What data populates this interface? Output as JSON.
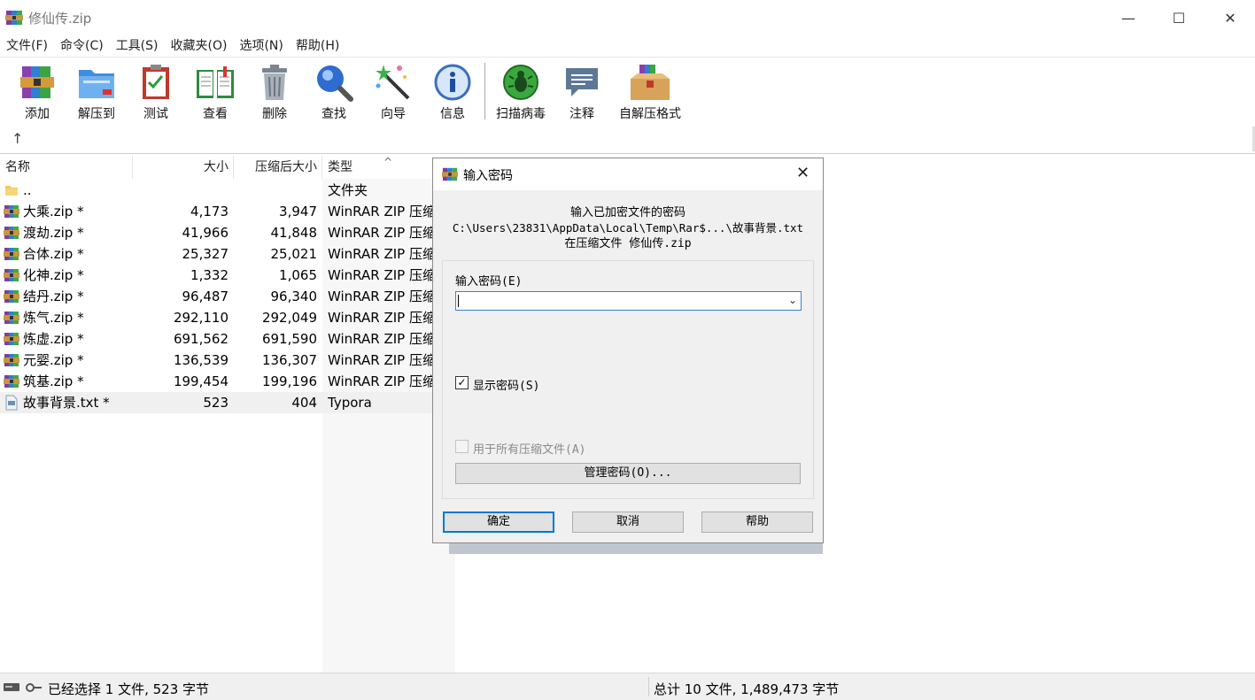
{
  "window": {
    "title": "修仙传.zip",
    "minimize": "—",
    "maximize": "☐",
    "close": "✕"
  },
  "menu": [
    "文件(F)",
    "命令(C)",
    "工具(S)",
    "收藏夹(O)",
    "选项(N)",
    "帮助(H)"
  ],
  "toolbar": {
    "buttons": [
      "添加",
      "解压到",
      "测试",
      "查看",
      "删除",
      "查找",
      "向导",
      "信息",
      "扫描病毒",
      "注释",
      "自解压格式"
    ],
    "up_arrow": "↑"
  },
  "list": {
    "headers": {
      "name": "名称",
      "size": "大小",
      "packed": "压缩后大小",
      "type": "类型"
    },
    "sort_indicator": "^",
    "rows": [
      {
        "name": "..",
        "size": "",
        "packed": "",
        "type": "文件夹",
        "icon": "folder-icon"
      },
      {
        "name": "大乘.zip *",
        "size": "4,173",
        "packed": "3,947",
        "type": "WinRAR ZIP 压缩",
        "icon": "winrar-archive-icon"
      },
      {
        "name": "渡劫.zip *",
        "size": "41,966",
        "packed": "41,848",
        "type": "WinRAR ZIP 压缩",
        "icon": "winrar-archive-icon"
      },
      {
        "name": "合体.zip *",
        "size": "25,327",
        "packed": "25,021",
        "type": "WinRAR ZIP 压缩",
        "icon": "winrar-archive-icon"
      },
      {
        "name": "化神.zip *",
        "size": "1,332",
        "packed": "1,065",
        "type": "WinRAR ZIP 压缩",
        "icon": "winrar-archive-icon"
      },
      {
        "name": "结丹.zip *",
        "size": "96,487",
        "packed": "96,340",
        "type": "WinRAR ZIP 压缩",
        "icon": "winrar-archive-icon"
      },
      {
        "name": "炼气.zip *",
        "size": "292,110",
        "packed": "292,049",
        "type": "WinRAR ZIP 压缩",
        "icon": "winrar-archive-icon"
      },
      {
        "name": "炼虚.zip *",
        "size": "691,562",
        "packed": "691,590",
        "type": "WinRAR ZIP 压缩",
        "icon": "winrar-archive-icon"
      },
      {
        "name": "元婴.zip *",
        "size": "136,539",
        "packed": "136,307",
        "type": "WinRAR ZIP 压缩",
        "icon": "winrar-archive-icon"
      },
      {
        "name": "筑基.zip *",
        "size": "199,454",
        "packed": "199,196",
        "type": "WinRAR ZIP 压缩",
        "icon": "winrar-archive-icon"
      },
      {
        "name": "故事背景.txt *",
        "size": "523",
        "packed": "404",
        "type": "Typora",
        "icon": "text-file-icon",
        "selected": true
      }
    ]
  },
  "status": {
    "left": "已经选择 1 文件, 523 字节",
    "right": "总计 10 文件, 1,489,473 字节"
  },
  "dialog": {
    "title": "输入密码",
    "close": "✕",
    "line1": "输入已加密文件的密码",
    "line2": "C:\\Users\\23831\\AppData\\Local\\Temp\\Rar$...\\故事背景.txt",
    "line3": "在压缩文件 修仙传.zip",
    "password_label": "输入密码(E)",
    "password_value": "",
    "show_password_label": "显示密码(S)",
    "show_password_checked": true,
    "all_archives_label": "用于所有压缩文件(A)",
    "all_archives_checked": false,
    "manage_button": "管理密码(O)...",
    "ok_button": "确定",
    "cancel_button": "取消",
    "help_button": "帮助"
  },
  "colors": {
    "accent": "#0078d7",
    "dialog_bg": "#f0f0f0",
    "selected_row": "#f0f0f0"
  }
}
